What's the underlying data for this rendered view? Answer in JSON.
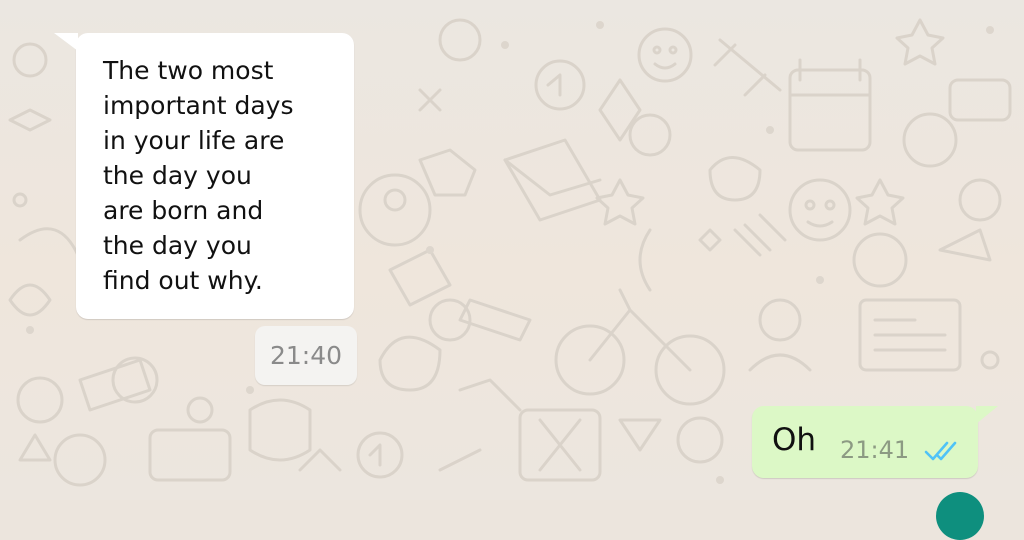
{
  "chat": {
    "incoming": {
      "text": "The two most\nimportant days\nin your life are\nthe day you\nare born and\nthe day you\nfind out why.",
      "time": "21:40"
    },
    "outgoing": {
      "text": "Oh",
      "time": "21:41",
      "status_icon": "double-check-icon",
      "status_color": "#4fc3f7"
    }
  },
  "colors": {
    "wallpaper": "#ece5dd",
    "incoming_bubble": "#ffffff",
    "outgoing_bubble": "#dcf8c6"
  }
}
